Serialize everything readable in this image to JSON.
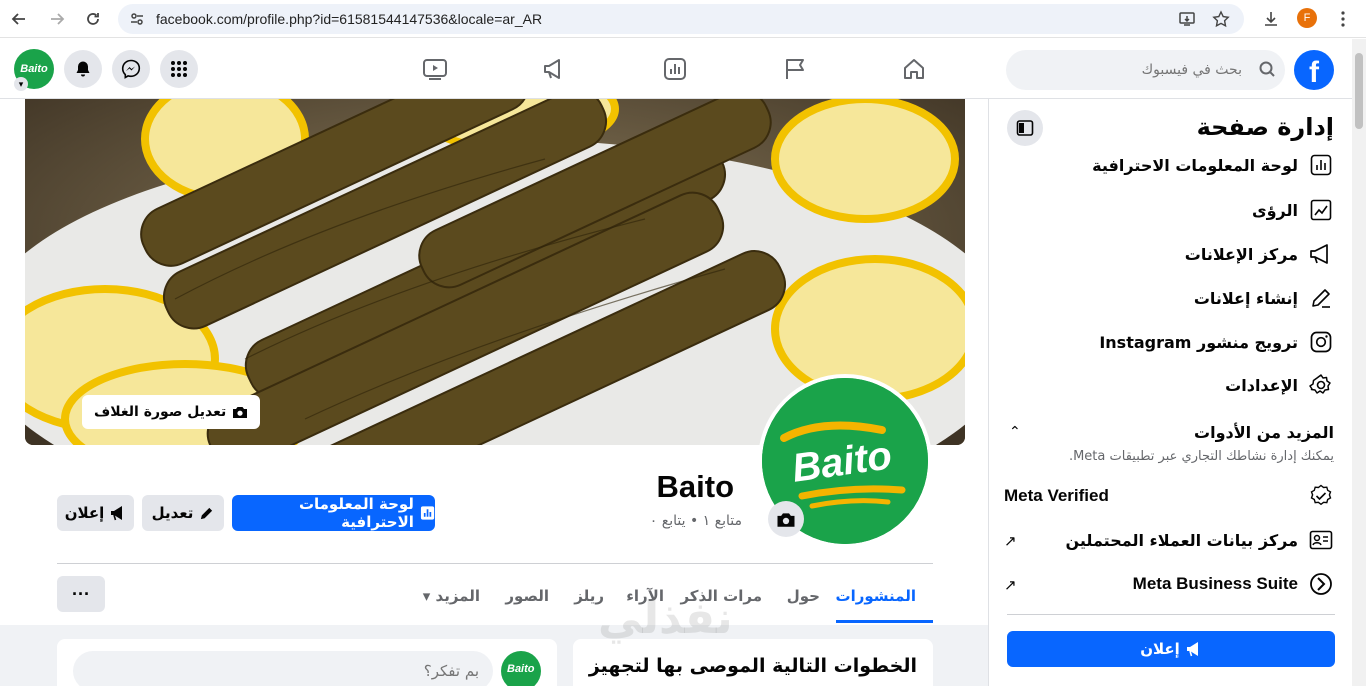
{
  "browser": {
    "url": "facebook.com/profile.php?id=61581544147536&locale=ar_AR",
    "profile_initial": "F"
  },
  "topnav": {
    "search_placeholder": "بحث في فيسبوك",
    "logo": "f",
    "avatar_text": "Baito"
  },
  "profile": {
    "cover_edit_label": "تعديل صورة الغلاف",
    "name": "Baito",
    "stats": "متابع ١ • يتابع ٠",
    "avatar_text": "Baito",
    "dashboard_label": "لوحة المعلومات الاحترافية",
    "edit_label": "تعديل",
    "promote_label": "إعلان",
    "more_dots": "···"
  },
  "tabs": [
    {
      "label": "المنشورات"
    },
    {
      "label": "حول"
    },
    {
      "label": "مرات الذكر"
    },
    {
      "label": "الآراء"
    },
    {
      "label": "ريلز"
    },
    {
      "label": "الصور"
    },
    {
      "label": "المزيد ▾"
    }
  ],
  "feed": {
    "composer_placeholder": "بم تفكر؟",
    "next_steps_title": "الخطوات التالية الموصى بها لتجهيز",
    "watermark": "نفذلي"
  },
  "sidebar": {
    "title": "إدارة صفحة",
    "items": [
      {
        "label": "لوحة المعلومات الاحترافية",
        "icon": "dashboard-icon"
      },
      {
        "label": "الرؤى",
        "icon": "insights-icon"
      },
      {
        "label": "مركز الإعلانات",
        "icon": "megaphone-icon"
      },
      {
        "label": "إنشاء إعلانات",
        "icon": "pencil-icon"
      },
      {
        "label": "ترويج منشور Instagram",
        "icon": "instagram-icon"
      },
      {
        "label": "الإعدادات",
        "icon": "gear-icon"
      }
    ],
    "more_tools_title": "المزيد من الأدوات",
    "more_tools_desc": "يمكنك إدارة نشاطك التجاري عبر تطبيقات Meta.",
    "tools": [
      {
        "label": "Meta Verified",
        "icon": "verified-badge-icon"
      },
      {
        "label": "مركز بيانات العملاء المحتملين",
        "icon": "contact-card-icon"
      },
      {
        "label": "Meta Business Suite",
        "icon": "business-suite-icon"
      }
    ],
    "promote_label": "إعلان"
  },
  "colors": {
    "brand": "#0866ff",
    "avatar_green": "#1aa34a",
    "grey_button": "#e4e6eb"
  }
}
